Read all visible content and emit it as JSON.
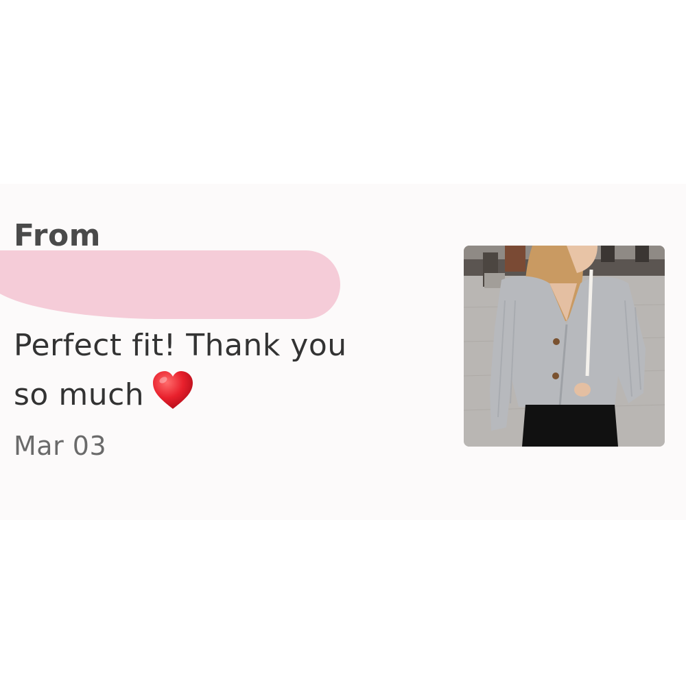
{
  "review": {
    "from_label": "From",
    "message": "Perfect fit! Thank you so much",
    "message_line1": "Perfect fit! Thank you",
    "message_line2": "so much",
    "emoji": "heart-icon",
    "date": "Mar 03"
  },
  "photo": {
    "subject": "woman-in-grey-cardigan"
  },
  "colors": {
    "card_background": "#fcfafa",
    "redaction": "#f5ccd8",
    "heart": "#e8202c",
    "text": "#333333",
    "date_text": "#6a6a6a"
  }
}
